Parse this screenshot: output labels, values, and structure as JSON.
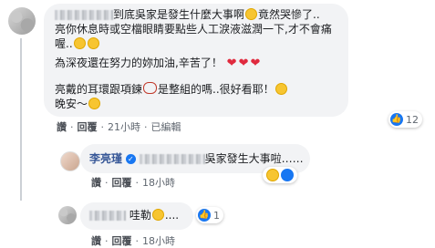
{
  "comment1": {
    "lines": [
      "到底吳家是發生什麼大事啊",
      "竟然哭慘了..",
      "亮你休息時或空檔眼睛要點些人工淚液滋潤一下,才不會痛",
      "喔..",
      "為深夜還在努力的妳加油,辛苦了！",
      "亮戴的耳環跟項鍊",
      "是整組的嗎..很好看耶！",
      "晚安～"
    ],
    "actions": [
      "讚",
      "回覆",
      "21小時",
      "已編輯"
    ],
    "reaction_count": "12"
  },
  "reply1": {
    "author": "李亮瑾",
    "text": "吳家發生大事啦……",
    "actions": [
      "讚",
      "回覆",
      "18小時"
    ]
  },
  "comment2": {
    "text": "哇勒",
    "ellipsis": "....",
    "reaction_count": "1",
    "actions": [
      "讚",
      "回覆",
      "18小時"
    ]
  },
  "colors": {
    "bubble": "#f2f3f5",
    "link": "#385898",
    "like": "#1877f2",
    "heart": "#e02a3e"
  }
}
